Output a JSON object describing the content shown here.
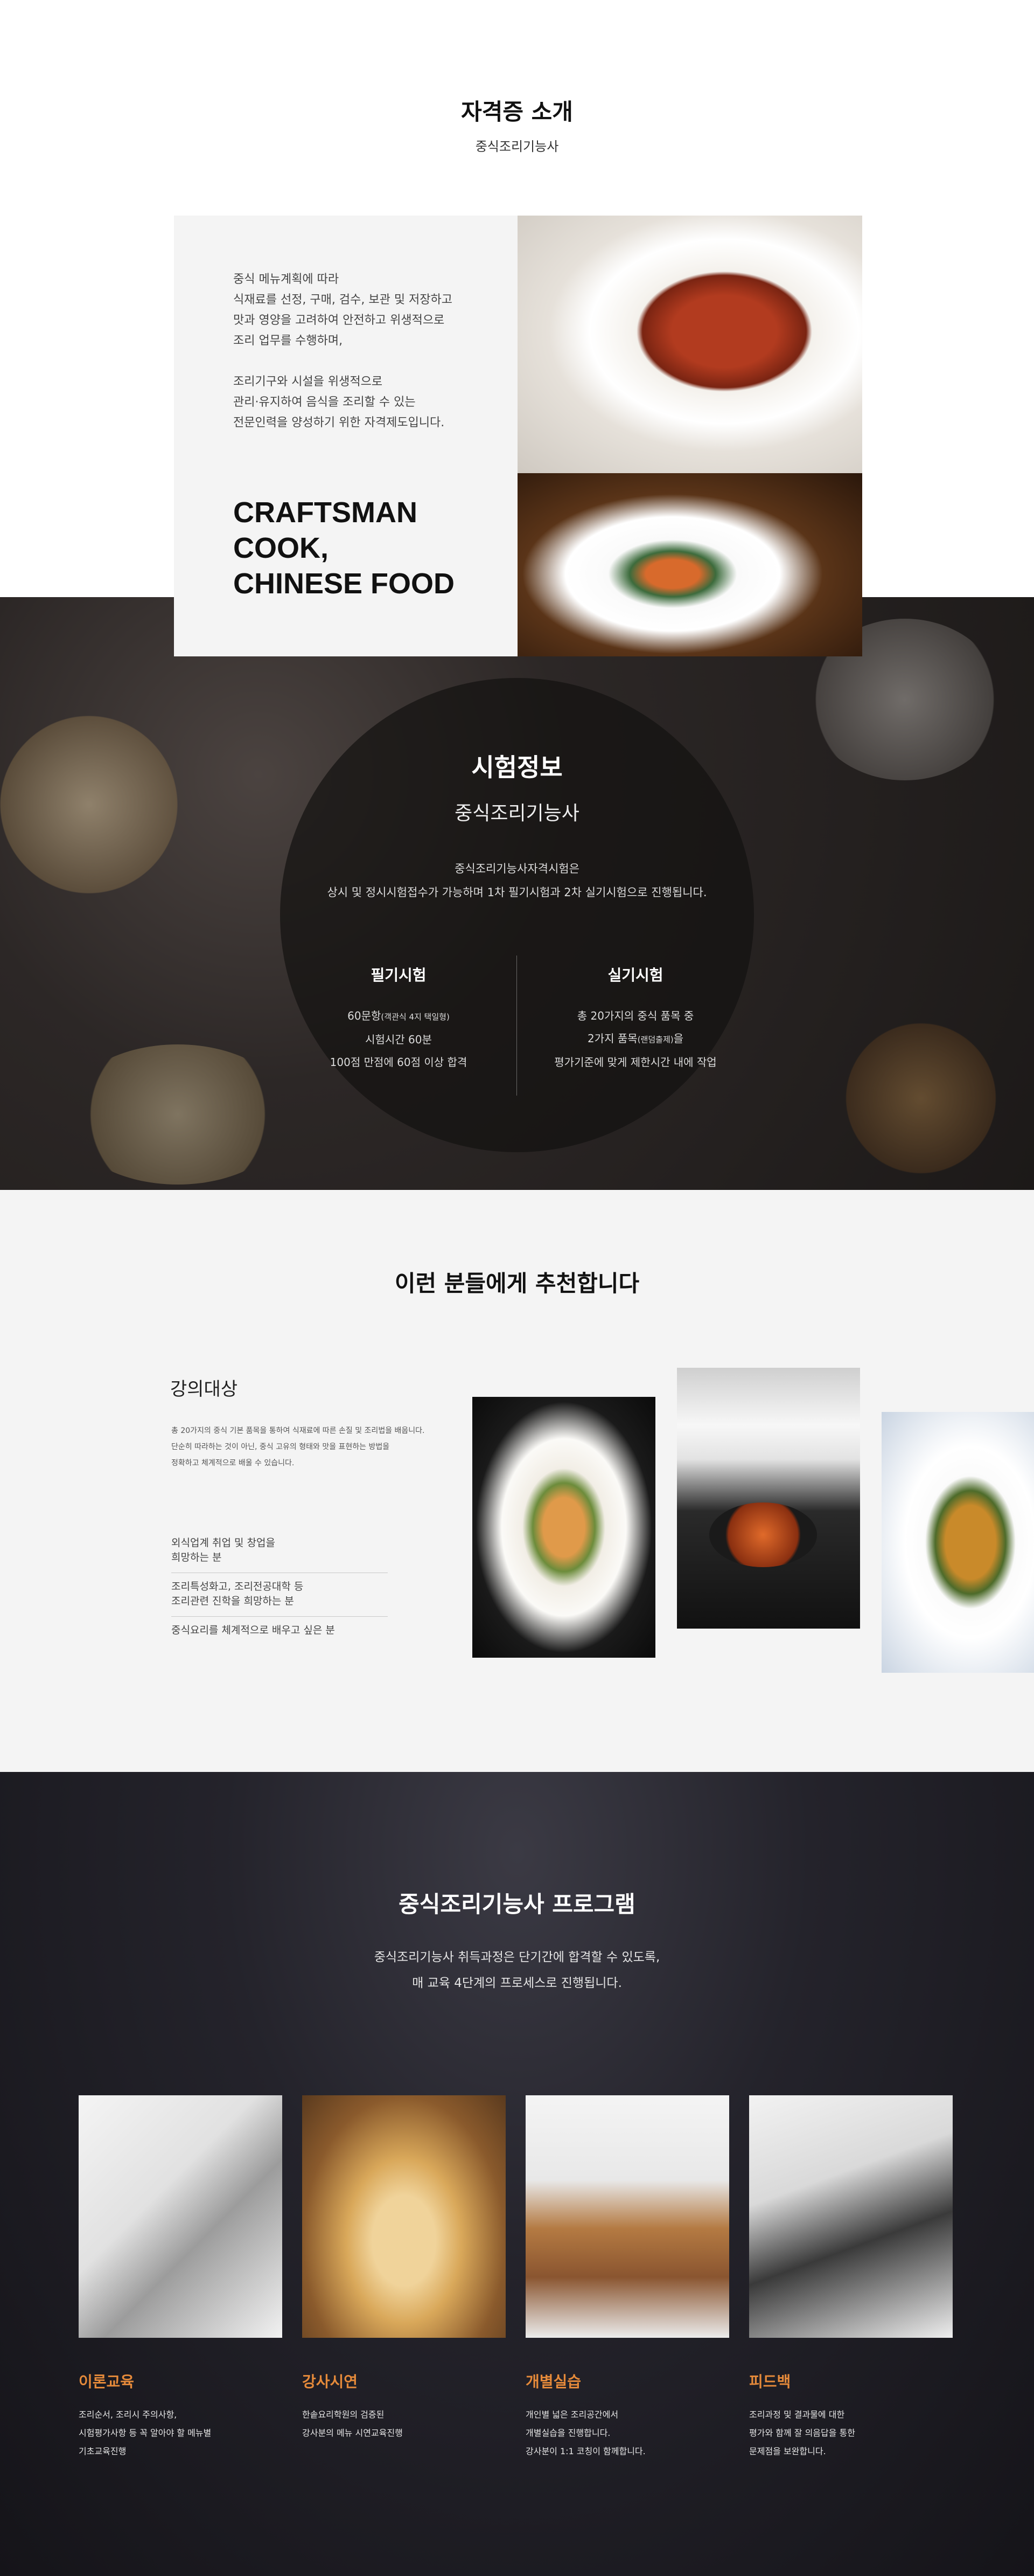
{
  "intro": {
    "title": "자격증 소개",
    "subtitle": "중식조리기능사",
    "desc_lines_a": [
      "중식 메뉴계획에 따라",
      "식재료를 선정, 구매, 검수, 보관 및 저장하고",
      "맛과 영양을 고려하여 안전하고 위생적으로",
      "조리 업무를 수행하며,"
    ],
    "desc_lines_b": [
      "조리기구와 시설을 위생적으로",
      "관리·유지하여 음식을 조리할 수 있는",
      "전문인력을 양성하기 위한 자격제도입니다."
    ],
    "craft_lines": [
      "CRAFTSMAN",
      "COOK,",
      "CHINESE FOOD"
    ]
  },
  "exam": {
    "title": "시험정보",
    "subtitle": "중식조리기능사",
    "intro_line1": "중식조리기능사자격시험은",
    "intro_line2": "상시 및 정시시험접수가 가능하며 1차 필기시험과 2차 실기시험으로 진행됩니다.",
    "written": {
      "title": "필기시험",
      "line1": "60문항",
      "line1_small": "(객관식 4지 택일형)",
      "line2": "시험시간 60분",
      "line3": "100점 만점에 60점 이상 합격"
    },
    "practical": {
      "title": "실기시험",
      "line1": "총 20가지의 중식 품목 중",
      "line2": "2가지 품목",
      "line2_small": "(랜덤출제)",
      "line2_end": "을",
      "line3": "평가기준에 맞게 제한시간 내에 작업"
    }
  },
  "recommend": {
    "title": "이런 분들에게 추천합니다",
    "subject": "강의대상",
    "desc_lines": [
      "총 20가지의 중식 기본 품목을 통하여 식재료에 따른 손질 및 조리법을 배웁니다.",
      "단순히 따라하는 것이 아닌, 중식 고유의 형태와 맛을 표현하는 방법을",
      "정확하고 체계적으로 배울 수 있습니다."
    ],
    "items": [
      [
        "외식업계 취업 및 창업을",
        "희망하는 분"
      ],
      [
        "조리특성화고, 조리전공대학 등",
        "조리관련 진학을 희망하는 분"
      ],
      [
        "중식요리를 체계적으로 배우고 싶은 분"
      ]
    ]
  },
  "program": {
    "title": "중식조리기능사 프로그램",
    "desc_line1": "중식조리기능사 취득과정은 단기간에 합격할 수 있도록,",
    "desc_line2": "매 교육 4단계의 프로세스로 진행됩니다.",
    "cards": [
      {
        "title": "이론교육",
        "lines": [
          "조리순서, 조리시 주의사항,",
          "시험평가사항 등 꼭 알아야 할 메뉴별",
          "기초교육진행"
        ]
      },
      {
        "title": "강사시연",
        "lines": [
          "한솥요리학원의 검증된",
          "강사분의 메뉴 시연교육진행"
        ]
      },
      {
        "title": "개별실습",
        "lines": [
          "개인별 넓은 조리공간에서",
          "개별실습을 진행합니다.",
          "강사분이 1:1 코칭이 함께합니다."
        ]
      },
      {
        "title": "피드백",
        "lines": [
          "조리과정 및 결과물에 대한",
          "평가와 함께 잘 의음답을 통한",
          "문제점을 보완합니다."
        ]
      }
    ]
  },
  "colors": {
    "accent_orange": "#e58a3a",
    "dark_bg": "#1c1918",
    "light_bg": "#f4f4f4"
  }
}
